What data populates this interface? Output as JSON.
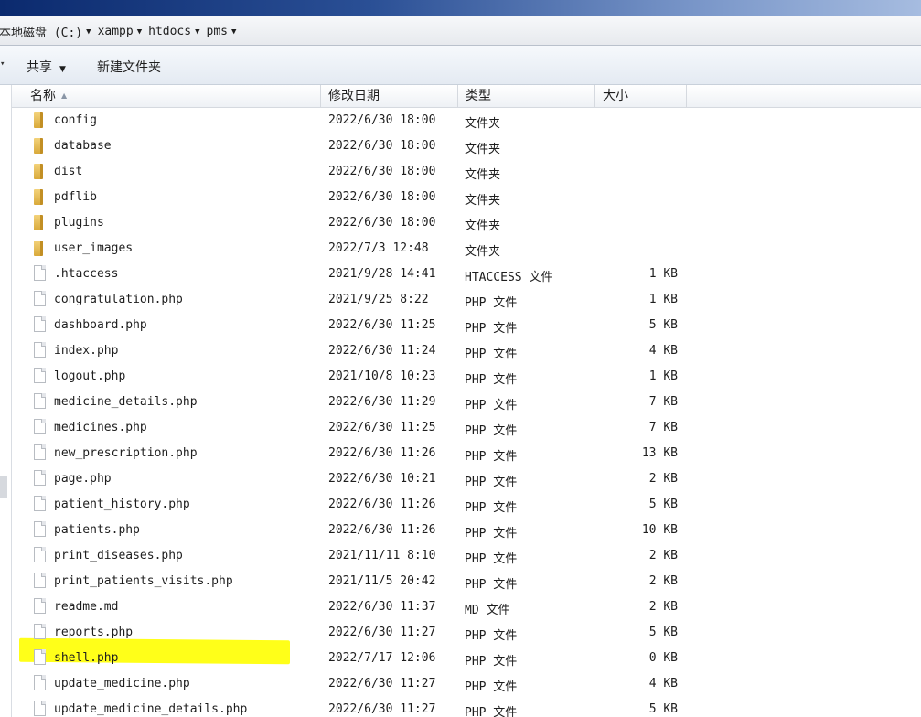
{
  "address": {
    "crumbs": [
      "本地磁盘 (C:)",
      "xampp",
      "htdocs",
      "pms"
    ]
  },
  "toolbar": {
    "share_label": "共享",
    "new_folder_label": "新建文件夹"
  },
  "columns": {
    "name": "名称",
    "date": "修改日期",
    "type": "类型",
    "size": "大小"
  },
  "files": [
    {
      "name": "config",
      "date": "2022/6/30 18:00",
      "type": "文件夹",
      "size": "",
      "icon": "folder-icon"
    },
    {
      "name": "database",
      "date": "2022/6/30 18:00",
      "type": "文件夹",
      "size": "",
      "icon": "folder-icon"
    },
    {
      "name": "dist",
      "date": "2022/6/30 18:00",
      "type": "文件夹",
      "size": "",
      "icon": "folder-icon"
    },
    {
      "name": "pdflib",
      "date": "2022/6/30 18:00",
      "type": "文件夹",
      "size": "",
      "icon": "folder-icon"
    },
    {
      "name": "plugins",
      "date": "2022/6/30 18:00",
      "type": "文件夹",
      "size": "",
      "icon": "folder-icon"
    },
    {
      "name": "user_images",
      "date": "2022/7/3 12:48",
      "type": "文件夹",
      "size": "",
      "icon": "folder-icon"
    },
    {
      "name": ".htaccess",
      "date": "2021/9/28 14:41",
      "type": "HTACCESS 文件",
      "size": "1 KB",
      "icon": "file-icon"
    },
    {
      "name": "congratulation.php",
      "date": "2021/9/25 8:22",
      "type": "PHP 文件",
      "size": "1 KB",
      "icon": "file-icon"
    },
    {
      "name": "dashboard.php",
      "date": "2022/6/30 11:25",
      "type": "PHP 文件",
      "size": "5 KB",
      "icon": "file-icon"
    },
    {
      "name": "index.php",
      "date": "2022/6/30 11:24",
      "type": "PHP 文件",
      "size": "4 KB",
      "icon": "file-icon"
    },
    {
      "name": "logout.php",
      "date": "2021/10/8 10:23",
      "type": "PHP 文件",
      "size": "1 KB",
      "icon": "file-icon"
    },
    {
      "name": "medicine_details.php",
      "date": "2022/6/30 11:29",
      "type": "PHP 文件",
      "size": "7 KB",
      "icon": "file-icon"
    },
    {
      "name": "medicines.php",
      "date": "2022/6/30 11:25",
      "type": "PHP 文件",
      "size": "7 KB",
      "icon": "file-icon"
    },
    {
      "name": "new_prescription.php",
      "date": "2022/6/30 11:26",
      "type": "PHP 文件",
      "size": "13 KB",
      "icon": "file-icon"
    },
    {
      "name": "page.php",
      "date": "2022/6/30 10:21",
      "type": "PHP 文件",
      "size": "2 KB",
      "icon": "file-icon"
    },
    {
      "name": "patient_history.php",
      "date": "2022/6/30 11:26",
      "type": "PHP 文件",
      "size": "5 KB",
      "icon": "file-icon"
    },
    {
      "name": "patients.php",
      "date": "2022/6/30 11:26",
      "type": "PHP 文件",
      "size": "10 KB",
      "icon": "file-icon"
    },
    {
      "name": "print_diseases.php",
      "date": "2021/11/11 8:10",
      "type": "PHP 文件",
      "size": "2 KB",
      "icon": "file-icon"
    },
    {
      "name": "print_patients_visits.php",
      "date": "2021/11/5 20:42",
      "type": "PHP 文件",
      "size": "2 KB",
      "icon": "file-icon"
    },
    {
      "name": "readme.md",
      "date": "2022/6/30 11:37",
      "type": "MD 文件",
      "size": "2 KB",
      "icon": "file-icon"
    },
    {
      "name": "reports.php",
      "date": "2022/6/30 11:27",
      "type": "PHP 文件",
      "size": "5 KB",
      "icon": "file-icon"
    },
    {
      "name": "shell.php",
      "date": "2022/7/17 12:06",
      "type": "PHP 文件",
      "size": "0 KB",
      "icon": "file-icon"
    },
    {
      "name": "update_medicine.php",
      "date": "2022/6/30 11:27",
      "type": "PHP 文件",
      "size": "4 KB",
      "icon": "file-icon"
    },
    {
      "name": "update_medicine_details.php",
      "date": "2022/6/30 11:27",
      "type": "PHP 文件",
      "size": "5 KB",
      "icon": "file-icon"
    }
  ],
  "colors": {
    "highlight": "#ffff00",
    "titlebar": "#0b2a6e"
  }
}
